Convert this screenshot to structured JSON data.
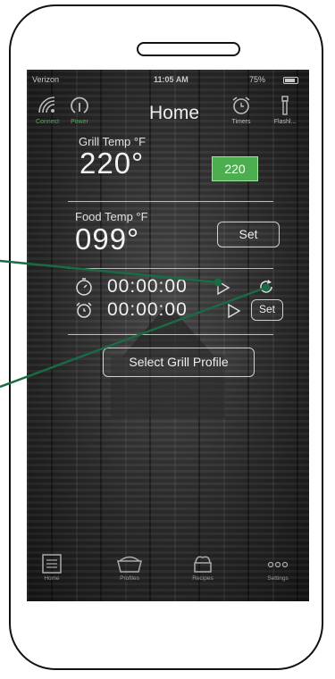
{
  "status_bar": {
    "carrier": "Verizon",
    "time": "11:05 AM",
    "battery": "75%"
  },
  "nav": {
    "title": "Home",
    "connect_label": "Connect",
    "power_label": "Power",
    "timers_label": "Timers",
    "flashlight_label": "Flashl..."
  },
  "grill": {
    "label": "Grill Temp °F",
    "value": "220°",
    "setpoint": "220"
  },
  "food": {
    "label": "Food Temp °F",
    "value": "099°",
    "set_label": "Set"
  },
  "timers": {
    "stopwatch_value": "00:00:00",
    "alarm_value": "00:00:00",
    "set_label": "Set"
  },
  "profile_button": "Select Grill Profile",
  "tabs": {
    "home": "Home",
    "profiles": "Profiles",
    "recipes": "Recipes",
    "settings": "Settings"
  },
  "colors": {
    "accent_green": "#4cae4f",
    "callout_line": "#1a6b45"
  },
  "icons": [
    "wifi-icon",
    "power-icon",
    "alarm-clock-icon",
    "flashlight-icon",
    "stopwatch-icon",
    "play-icon",
    "refresh-icon",
    "home-icon",
    "grill-icon",
    "recipes-icon",
    "more-icon"
  ]
}
